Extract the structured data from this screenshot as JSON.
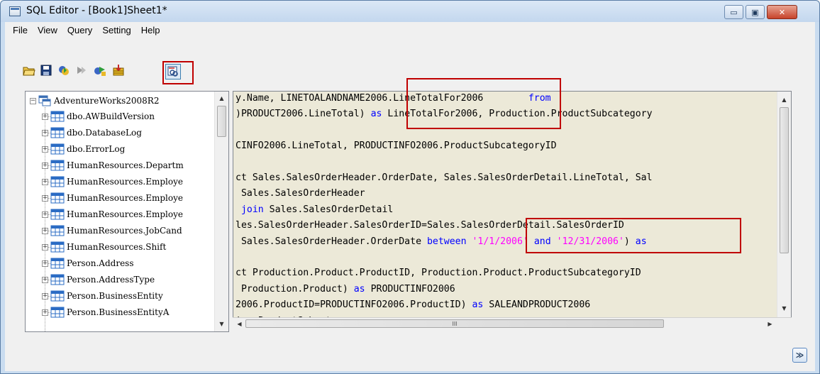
{
  "window": {
    "title": "SQL Editor - [Book1]Sheet1*",
    "controls": {
      "minimize": "▭",
      "maximize": "▣",
      "close": "✕"
    }
  },
  "menubar": {
    "items": [
      "File",
      "View",
      "Query",
      "Setting",
      "Help"
    ]
  },
  "toolbar": {
    "buttons": [
      "open-icon",
      "save-icon",
      "run-icon",
      "stop-icon",
      "connect-icon",
      "import-icon",
      "query-builder-icon"
    ],
    "highlighted": "query-builder-icon"
  },
  "tree": {
    "root": "AdventureWorks2008R2",
    "items": [
      "dbo.AWBuildVersion",
      "dbo.DatabaseLog",
      "dbo.ErrorLog",
      "HumanResources.Departm",
      "HumanResources.Employe",
      "HumanResources.Employe",
      "HumanResources.Employe",
      "HumanResources.JobCand",
      "HumanResources.Shift",
      "Person.Address",
      "Person.AddressType",
      "Person.BusinessEntity",
      "Person.BusinessEntityA"
    ]
  },
  "editor": {
    "lines": [
      [
        {
          "t": "y.Name, LINETOALANDNAME2006.LineTotalFor2006        "
        },
        {
          "t": "from",
          "k": "kw"
        }
      ],
      [
        {
          "t": ")PRODUCT2006.LineTotal) "
        },
        {
          "t": "as",
          "k": "kw"
        },
        {
          "t": " LineTotalFor2006, Production.ProductSubcategory"
        }
      ],
      [
        {
          "t": ""
        }
      ],
      [
        {
          "t": "CINFO2006.LineTotal, PRODUCTINFO2006.ProductSubcategoryID"
        }
      ],
      [
        {
          "t": ""
        }
      ],
      [
        {
          "t": "ct Sales.SalesOrderHeader.OrderDate, Sales.SalesOrderDetail.LineTotal, Sal"
        }
      ],
      [
        {
          "t": " Sales.SalesOrderHeader"
        }
      ],
      [
        {
          "t": " "
        },
        {
          "t": "join",
          "k": "kw"
        },
        {
          "t": " Sales.SalesOrderDetail"
        }
      ],
      [
        {
          "t": "les.SalesOrderHeader.SalesOrderID=Sales.SalesOrderDetail.SalesOrderID"
        }
      ],
      [
        {
          "t": " Sales.SalesOrderHeader.OrderDate "
        },
        {
          "t": "between",
          "k": "kw"
        },
        {
          "t": " "
        },
        {
          "t": "'1/1/2006'",
          "k": "str"
        },
        {
          "t": " "
        },
        {
          "t": "and",
          "k": "kw"
        },
        {
          "t": " "
        },
        {
          "t": "'12/31/2006'",
          "k": "str"
        },
        {
          "t": ") "
        },
        {
          "t": "as",
          "k": "kw"
        }
      ],
      [
        {
          "t": ""
        }
      ],
      [
        {
          "t": "ct Production.Product.ProductID, Production.Product.ProductSubcategoryID"
        }
      ],
      [
        {
          "t": " Production.Product) "
        },
        {
          "t": "as",
          "k": "kw"
        },
        {
          "t": " PRODUCTINFO2006"
        }
      ],
      [
        {
          "t": "2006.ProductID=PRODUCTINFO2006.ProductID) "
        },
        {
          "t": "as",
          "k": "kw"
        },
        {
          "t": " SALEANDPRODUCT2006"
        }
      ],
      [
        {
          "t": "ion.ProductSubcategory"
        }
      ]
    ],
    "hscroll_grip": "III"
  },
  "bottom": {
    "expand_label": "≫"
  },
  "colors": {
    "keyword": "#0000ff",
    "string": "#ff00ff",
    "highlight": "#c00000"
  }
}
